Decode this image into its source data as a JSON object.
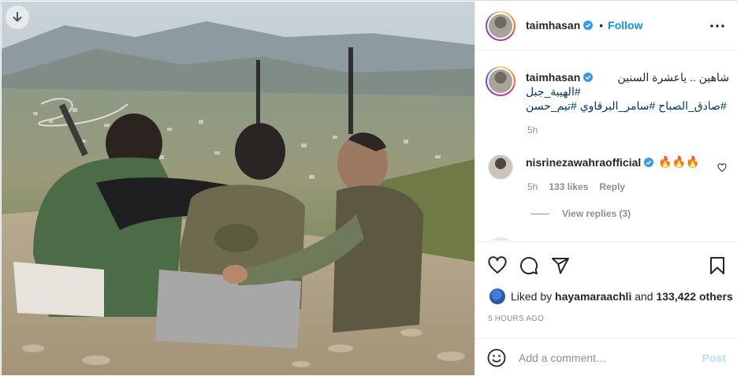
{
  "post": {
    "username": "taimhasan",
    "follow_label": "Follow",
    "separator": "•"
  },
  "caption": {
    "username": "taimhasan",
    "line1": "شاهين .. ياعشرة السنين",
    "line2": "#الهيبة_جبل",
    "line3": "#صادق_الصباح #سامر_البرقاوي #تيم_حسن",
    "time": "5h"
  },
  "comment": {
    "username": "nisrinezawahraofficial",
    "text": "🔥🔥🔥",
    "time": "5h",
    "likes": "133 likes",
    "reply_label": "Reply",
    "view_replies": "View replies (3)"
  },
  "likes": {
    "prefix": "Liked by",
    "user": "hayamaraachli",
    "middle": "and",
    "count": "133,422 others"
  },
  "timestamp": "5 HOURS AGO",
  "add_comment": {
    "placeholder": "Add a comment…",
    "post_label": "Post"
  },
  "icons": {
    "download": "download-icon",
    "verified": "verified-badge-icon",
    "more": "more-options-icon",
    "like": "heart-icon",
    "comment": "comment-icon",
    "share": "paper-plane-icon",
    "save": "bookmark-icon",
    "emoji": "emoji-icon"
  },
  "colors": {
    "link": "#0095f6",
    "hashtag": "#00376b",
    "muted": "#8e8e8e",
    "verified": "#3897f0",
    "post_disabled": "#b2dffc"
  }
}
